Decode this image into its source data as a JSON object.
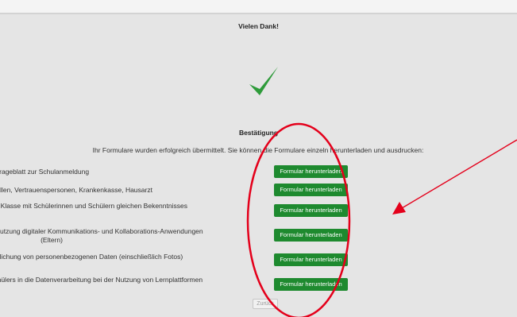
{
  "page": {
    "title": "Vielen Dank!",
    "subtitle": "Bestätigung",
    "message": "Ihr Formulare wurden erfolgreich übermittelt. Sie können die Formulare einzeln herunterladen und ausdrucken:",
    "back_label": "Zurück"
  },
  "forms": [
    {
      "label": "Frageblatt zur Schulanmeldung",
      "button": "Formular herunterladen"
    },
    {
      "label": "Erreichbarkeit in Notfällen, Vertrauenspersonen, Krankenkasse, Hausarzt",
      "button": "Formular herunterladen"
    },
    {
      "label": "Erklärung über den Besuch einer Klasse mit Schülerinnen und Schülern gleichen Bekenntnisses",
      "button": "Formular herunterladen"
    },
    {
      "label": "Einwilligung Datenverarbeitung Nutzung digitaler Kommunikations- und Kollaborations-Anwendungen (Eltern)",
      "button": "Formular herunterladen"
    },
    {
      "label": "Einwilligung in die Veröffentlichung von personenbezogenen Daten (einschließlich Fotos)",
      "button": "Formular herunterladen"
    },
    {
      "label": "Einwilligung der Schülerin/des Schülers in die Datenverarbeitung bei der Nutzung von Lernplattformen",
      "button": "Formular herunterladen"
    }
  ],
  "colors": {
    "button_green": "#1e8a2f",
    "checkmark_green": "#2e9b3a",
    "annotation_red": "#e4001b",
    "panel_background": "#e5e5e5"
  },
  "annotations": {
    "ellipse": "red-ellipse",
    "arrow": "red-arrow"
  }
}
